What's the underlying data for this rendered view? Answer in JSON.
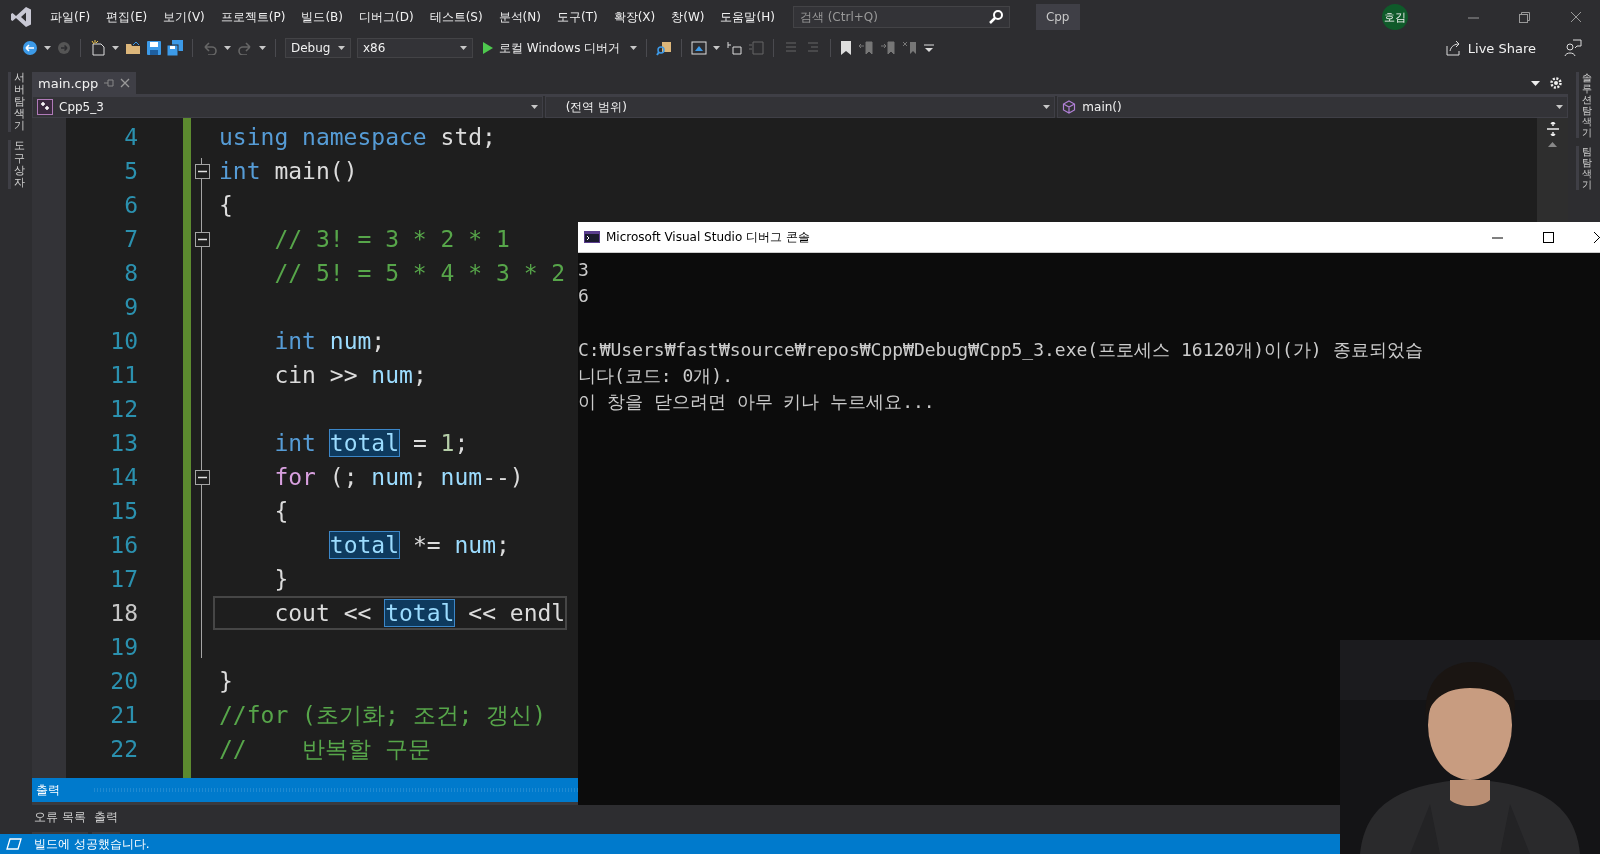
{
  "menu_bar": {
    "items": [
      "파일(F)",
      "편집(E)",
      "보기(V)",
      "프로젝트(P)",
      "빌드(B)",
      "디버그(D)",
      "테스트(S)",
      "분석(N)",
      "도구(T)",
      "확장(X)",
      "창(W)",
      "도움말(H)"
    ],
    "search": {
      "placeholder": "검색 (Ctrl+Q)"
    },
    "solution": "Cpp",
    "avatar": "호김"
  },
  "toolbar": {
    "configuration": "Debug",
    "platform": "x86",
    "run_button": "로컬 Windows 디버거",
    "live_share": "Live Share"
  },
  "side_tabs_left": [
    "서버 탐색기",
    "도구 상자"
  ],
  "side_tabs_right": [
    "솔루션 탐색기",
    "팀 탐색기"
  ],
  "document_tabs": [
    {
      "label": "main.cpp",
      "selected": true
    }
  ],
  "navigation": {
    "project": "Cpp5_3",
    "scope": "(전역 범위)",
    "member": "main()"
  },
  "code_lines": [
    {
      "number": "4",
      "fold": false,
      "current": false,
      "tokens": [
        {
          "kind": "keyword",
          "text": "using namespace"
        },
        {
          "kind": "plain",
          "text": " std;"
        }
      ]
    },
    {
      "number": "5",
      "fold": true,
      "current": false,
      "tokens": [
        {
          "kind": "keyword",
          "text": "int"
        },
        {
          "kind": "plain",
          "text": " main()"
        }
      ]
    },
    {
      "number": "6",
      "fold": false,
      "current": false,
      "tokens": [
        {
          "kind": "plain",
          "text": "{"
        }
      ]
    },
    {
      "number": "7",
      "fold": true,
      "current": false,
      "tokens": [
        {
          "kind": "comment",
          "text": "    // 3! = 3 * 2 * 1"
        }
      ]
    },
    {
      "number": "8",
      "fold": false,
      "current": false,
      "tokens": [
        {
          "kind": "comment",
          "text": "    // 5! = 5 * 4 * 3 * 2"
        }
      ]
    },
    {
      "number": "9",
      "fold": false,
      "current": false
    },
    {
      "number": "10",
      "fold": false,
      "current": false,
      "tokens": [
        {
          "kind": "keyword",
          "text": "    int"
        },
        {
          "kind": "variable",
          "text": " num"
        },
        {
          "kind": "plain",
          "text": ";"
        }
      ]
    },
    {
      "number": "11",
      "fold": false,
      "current": false,
      "tokens": [
        {
          "kind": "plain",
          "text": "    cin >> "
        },
        {
          "kind": "variable",
          "text": "num"
        },
        {
          "kind": "plain",
          "text": ";"
        }
      ]
    },
    {
      "number": "12",
      "fold": false,
      "current": false
    },
    {
      "number": "13",
      "fold": false,
      "current": false,
      "tokens": [
        {
          "kind": "keyword",
          "text": "    int"
        },
        {
          "kind": "highlight",
          "text": " total"
        },
        {
          "kind": "plain",
          "text": " = "
        },
        {
          "kind": "number",
          "text": "1"
        },
        {
          "kind": "plain",
          "text": ";"
        }
      ]
    },
    {
      "number": "14",
      "fold": true,
      "current": false,
      "tokens": [
        {
          "kind": "control",
          "text": "    for"
        },
        {
          "kind": "plain",
          "text": " (; "
        },
        {
          "kind": "variable",
          "text": "num"
        },
        {
          "kind": "plain",
          "text": "; "
        },
        {
          "kind": "variable",
          "text": "num"
        },
        {
          "kind": "plain",
          "text": "--)"
        }
      ]
    },
    {
      "number": "15",
      "fold": false,
      "current": false,
      "tokens": [
        {
          "kind": "plain",
          "text": "    {"
        }
      ]
    },
    {
      "number": "16",
      "fold": false,
      "current": false,
      "tokens": [
        {
          "kind": "highlight",
          "text": "        total"
        },
        {
          "kind": "plain",
          "text": " *= "
        },
        {
          "kind": "variable",
          "text": "num"
        },
        {
          "kind": "plain",
          "text": ";"
        }
      ]
    },
    {
      "number": "17",
      "fold": false,
      "current": false,
      "tokens": [
        {
          "kind": "plain",
          "text": "    }"
        }
      ]
    },
    {
      "number": "18",
      "fold": false,
      "current": true,
      "tokens": [
        {
          "kind": "plain",
          "text": "    cout << "
        },
        {
          "kind": "highlight",
          "text": "total"
        },
        {
          "kind": "plain",
          "text": " << endl"
        }
      ]
    },
    {
      "number": "19",
      "fold": false,
      "current": false
    },
    {
      "number": "20",
      "fold": false,
      "current": false,
      "tokens": [
        {
          "kind": "plain",
          "text": "}"
        }
      ]
    },
    {
      "number": "21",
      "fold": false,
      "current": false,
      "tokens": [
        {
          "kind": "comment",
          "text": "//for (초기화; 조건; 갱신)"
        }
      ]
    },
    {
      "number": "22",
      "fold": false,
      "current": false,
      "tokens": [
        {
          "kind": "comment",
          "text": "//    반복할 구문"
        }
      ]
    }
  ],
  "console": {
    "title": "Microsoft Visual Studio 디버그 콘솔",
    "blocks": [
      [
        "3",
        "6"
      ],
      [
        "C:₩Users₩fast₩source₩repos₩Cpp₩Debug₩Cpp5_3.exe(프로세스 16120개)이(가) 종료되었습",
        "니다(코드: 0개).",
        "이 창을 닫으려면 아무 키나 누르세요..."
      ]
    ]
  },
  "output_panel": {
    "title": "출력",
    "tabs": [
      {
        "label": "오류 목록",
        "selected": false
      },
      {
        "label": "출력",
        "selected": false
      }
    ]
  },
  "status_bar": {
    "message": "빌드에 성공했습니다."
  },
  "video": {
    "kind": "picture"
  }
}
